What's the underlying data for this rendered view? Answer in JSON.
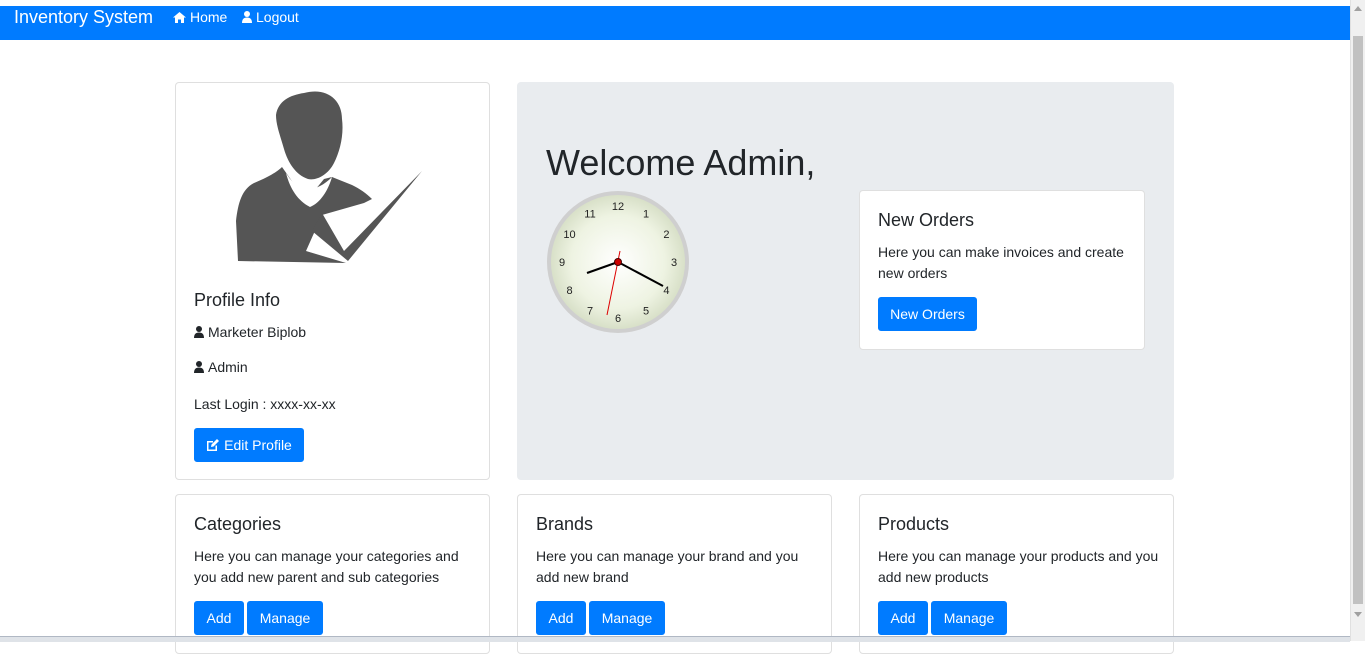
{
  "navbar": {
    "brand": "Inventory System",
    "links": [
      {
        "label": "Home",
        "icon": "home-icon"
      },
      {
        "label": "Logout",
        "icon": "user-icon"
      }
    ],
    "color": "#007bff"
  },
  "profile": {
    "title": "Profile Info",
    "name": "Marketer Biplob",
    "role": "Admin",
    "last_login": "Last Login : xxxx-xx-xx",
    "edit_label": "Edit Profile"
  },
  "welcome": {
    "heading": "Welcome Admin,"
  },
  "new_orders": {
    "title": "New Orders",
    "text": "Here you can make invoices and create new orders",
    "button": "New Orders"
  },
  "categories": {
    "title": "Categories",
    "text": "Here you can manage your categories and you add new parent and sub categories",
    "add": "Add",
    "manage": "Manage"
  },
  "brands": {
    "title": "Brands",
    "text": "Here you can manage your brand and you add new brand",
    "add": "Add",
    "manage": "Manage"
  },
  "products": {
    "title": "Products",
    "text": "Here you can manage your products and you add new products",
    "add": "Add",
    "manage": "Manage"
  },
  "clock": {
    "numbers": [
      "12",
      "1",
      "2",
      "3",
      "4",
      "5",
      "6",
      "7",
      "8",
      "9",
      "10",
      "11"
    ]
  }
}
